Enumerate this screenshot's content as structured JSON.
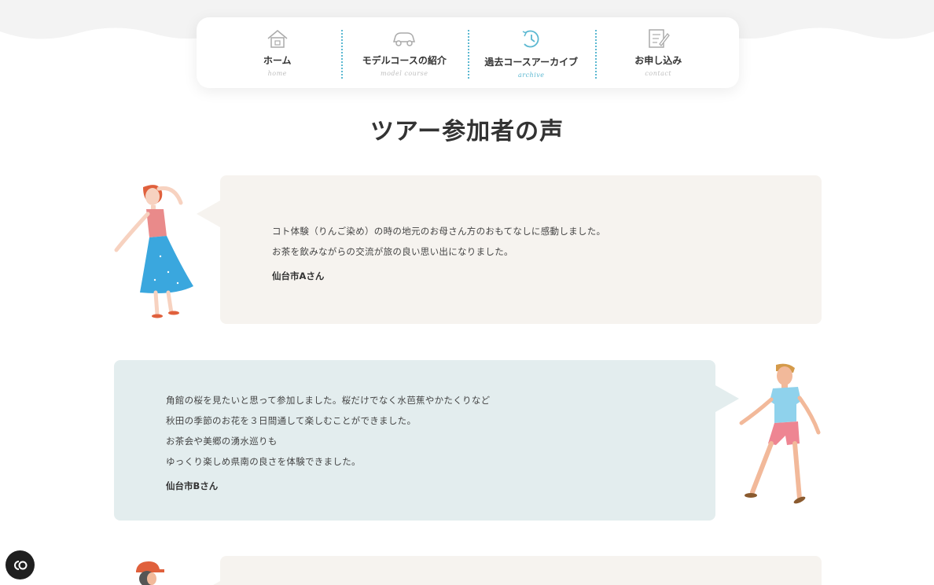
{
  "nav": {
    "items": [
      {
        "label": "ホーム",
        "sub": "home",
        "icon": "house-icon",
        "active": false
      },
      {
        "label": "モデルコースの紹介",
        "sub": "model course",
        "icon": "car-icon",
        "active": false
      },
      {
        "label": "過去コースアーカイブ",
        "sub": "archive",
        "icon": "history-icon",
        "active": true
      },
      {
        "label": "お申し込み",
        "sub": "contact",
        "icon": "form-icon",
        "active": false
      }
    ]
  },
  "page": {
    "title": "ツアー参加者の声"
  },
  "testimonials": [
    {
      "lines": [
        "コト体験（りんご染め）の時の地元のお母さん方のおもてなしに感動しました。",
        "お茶を飲みながらの交流が旅の良い思い出になりました。"
      ],
      "author": "仙台市Aさん"
    },
    {
      "lines": [
        "角館の桜を見たいと思って参加しました。桜だけでなく水芭蕉やかたくりなど",
        "秋田の季節のお花を３日間通して楽しむことができました。",
        "お茶会や美郷の湧水巡りも",
        "ゆっくり楽しめ県南の良さを体験できました。"
      ],
      "author": "仙台市Bさん"
    }
  ],
  "colors": {
    "accent": "#5bb8d1",
    "card_beige": "#f6f3ef",
    "card_blue": "#e3edee"
  },
  "cookie": {
    "icon": "cookie-consent-icon"
  }
}
